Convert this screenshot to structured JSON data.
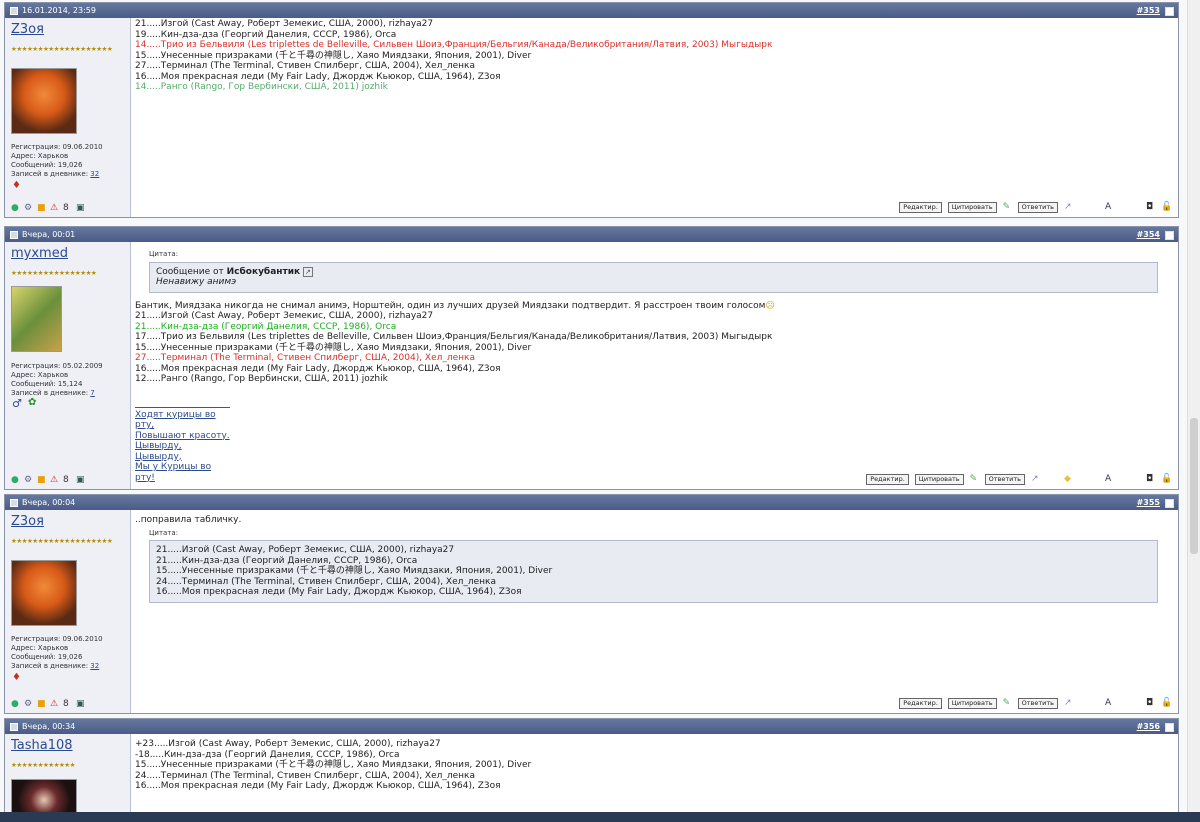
{
  "posts": [
    {
      "date": "16.01.2014, 23:59",
      "number": "#353",
      "user": {
        "name": "Z3оя",
        "info": [
          "Регистрация: 09.06.2010",
          "Адрес: Харьков",
          "Сообщений: 19,026"
        ],
        "diary_label": "Записей в дневнике:",
        "diary_count": "32"
      },
      "lines": [
        "21.....Изгой (Cast Away, Роберт Земекис, США, 2000), rizhaya27",
        "19.....Кин-дза-дза (Георгий Данелия, СССР, 1986), Orca",
        "14.....Трио из Бельвиля (Les triplettes de Belleville, Сильвен Шоиэ,Франция/Бельгия/Канада/Великобритания/Латвия, 2003) Мыгыдырк",
        "15.....Унесенные призраками (千と千尋の神隠し, Хаяо Миядзаки, Япония, 2001), Diver",
        "27.....Терминал (The Terminal, Стивен Спилберг, США, 2004), Хел_ленка",
        "16.....Моя прекрасная леди (My Fair Lady, Джордж Кьюкор, США, 1964), Z3оя",
        "14.....Ранго (Rango, Гор Вербински, США, 2011) jozhik"
      ],
      "line_colors": [
        "#222222",
        "#222222",
        "#d9302a",
        "#222222",
        "#222222",
        "#222222",
        "#57ad6e"
      ],
      "buttons": {
        "edit": "Редактир.",
        "quote": "Цитировать",
        "reply": "Ответить"
      }
    },
    {
      "date": "Вчера, 00:01",
      "number": "#354",
      "user": {
        "name": "myxmed",
        "info": [
          "Регистрация: 05.02.2009",
          "Адрес: Харьков",
          "Сообщений: 15,124"
        ],
        "diary_label": "Записей в дневнике:",
        "diary_count": "7"
      },
      "quote_label": "Цитата:",
      "quote_from_prefix": "Сообщение от",
      "quote_author": "Исбокубантик",
      "quote_text": "Ненавижу анимэ",
      "intro": "Бантик, Миядзака никогда не снимал анимэ, Норштейн, один из лучших друзей Миядзаки подтвердит. Я расстроен твоим голосом",
      "lines": [
        "21.....Изгой (Cast Away, Роберт Земекис, США, 2000), rizhaya27",
        "21.....Кин-дза-дза (Георгий Данелия, СССР, 1986), Orca",
        "17.....Трио из Бельвиля (Les triplettes de Belleville, Сильвен Шоиэ,Франция/Бельгия/Канада/Великобритания/Латвия, 2003) Мыгыдырк",
        "15.....Унесенные призраками (千と千尋の神隠し, Хаяо Миядзаки, Япония, 2001), Diver",
        "27.....Терминал (The Terminal, Стивен Спилберг, США, 2004), Хел_ленка",
        "16.....Моя прекрасная леди (My Fair Lady, Джордж Кьюкор, США, 1964), Z3оя",
        "12.....Ранго (Rango, Гор Вербински, США, 2011) jozhik"
      ],
      "line_colors": [
        "#222222",
        "#1eaf22",
        "#222222",
        "#222222",
        "#d9302a",
        "#222222",
        "#222222"
      ],
      "signature": [
        "Ходят курицы во рту,",
        "Повышают красоту.",
        "Цывырду, Цывырду,",
        "Мы у Курицы во рту!"
      ],
      "buttons": {
        "edit": "Редактир.",
        "quote": "Цитировать",
        "reply": "Ответить"
      }
    },
    {
      "date": "Вчера, 00:04",
      "number": "#355",
      "user": {
        "name": "Z3оя",
        "info": [
          "Регистрация: 09.06.2010",
          "Адрес: Харьков",
          "Сообщений: 19,026"
        ],
        "diary_label": "Записей в дневнике:",
        "diary_count": "32"
      },
      "intro": "..поправила табличку.",
      "quote_label": "Цитата:",
      "quote_lines": [
        "21.....Изгой (Cast Away, Роберт Земекис, США, 2000), rizhaya27",
        "21.....Кин-дза-дза (Георгий Данелия, СССР, 1986), Orca",
        "15.....Унесенные призраками (千と千尋の神隠し, Хаяо Миядзаки, Япония, 2001), Diver",
        "24.....Терминал (The Terminal, Стивен Спилберг, США, 2004), Хел_ленка",
        "16.....Моя прекрасная леди (My Fair Lady, Джордж Кьюкор, США, 1964), Z3оя"
      ],
      "buttons": {
        "edit": "Редактир.",
        "quote": "Цитировать",
        "reply": "Ответить"
      }
    },
    {
      "date": "Вчера, 00:34",
      "number": "#356",
      "user": {
        "name": "Tasha108"
      },
      "lines": [
        "+23.....Изгой (Cast Away, Роберт Земекис, США, 2000), rizhaya27",
        "-18.....Кин-дза-дза (Георгий Данелия, СССР, 1986), Orca",
        "15.....Унесенные призраками (千と千尋の神隠し, Хаяо Миядзаки, Япония, 2001), Diver",
        "24.....Терминал (The Terminal, Стивен Спилберг, США, 2004), Хел_ленка",
        "16.....Моя прекрасная леди (My Fair Lady, Джордж Кьюкор, США, 1964), Z3оя"
      ]
    }
  ]
}
